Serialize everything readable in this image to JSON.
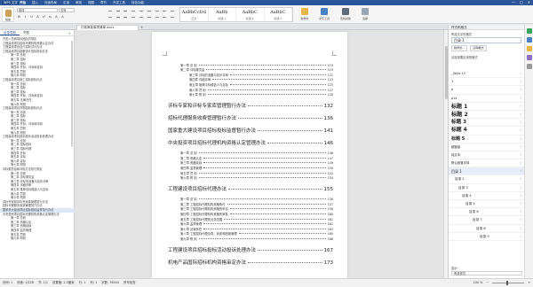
{
  "app": {
    "logo": "WPS 文字",
    "menu": [
      "开始",
      "插入",
      "页面布局",
      "引用",
      "审阅",
      "视图",
      "章节",
      "开发工具",
      "特色功能"
    ],
    "active_menu": "开始",
    "window_buttons": [
      "—",
      "□",
      "×"
    ]
  },
  "ribbon": {
    "paste_label": "粘贴",
    "font_name": "宋体",
    "font_size": "五号",
    "format_buttons": [
      "B",
      "I",
      "U",
      "A",
      "x²",
      "x₂",
      "A",
      "A"
    ],
    "styles": [
      {
        "preview": "AaBbCcDd",
        "name": "正文"
      },
      {
        "preview": "AaBb",
        "name": "标题 1"
      },
      {
        "preview": "AaBbC",
        "name": "标题 2"
      },
      {
        "preview": "AaBbC",
        "name": "标题 3"
      }
    ],
    "new_style_label": "新样式",
    "text_tools_label": "文字工具",
    "find_replace_label": "查找替换",
    "select_label": "选择"
  },
  "tabs": {
    "doc_tab": "行政审批事项清单.docx",
    "plus": "+"
  },
  "left_pane": {
    "tabs": [
      "目录导航",
      "书签"
    ],
    "close": "×",
    "outline": [
      "开发人员和招标团队的规定",
      "工程建设项目招标代理机构资格认定办法",
      "工程建设项目自行招标试行办法",
      "工程建设项目勘察设计招标投标办法",
      "  第一章  总则",
      "  第二章  招标",
      "  第三章  投标",
      "  第四章  开标、评标和定标",
      "  第五章  罚则",
      "  第六章  附则",
      "工程建设项目施工招标投标办法",
      "  第一章  总则",
      "  第二章  招标",
      "  第三章  投标",
      "  第四章  开标、评标和定标",
      "  第五章  法律责任",
      "  第六章  附则",
      "工程建设项目货物招标投标办法",
      "  第一章  总则",
      "  第二章  招标",
      "  第三章  投标",
      "  第四章  开标、评标和中标",
      "  第五章  罚则",
      "  第六章  附则",
      "工程建设项目招标投标活动投诉处理办法",
      "  第一章  总则",
      "  第二章  招标投标",
      "  第三章  招标代理",
      "  第四章  开标",
      "  第五章  评标",
      "  第六章  定标",
      "  第七章  附则",
      "评标委员会和评标方法暂行规定",
      "  第一章  总则",
      "  第二章  评标委员会",
      "  第三章  评标的准备与初步评审",
      "  第四章  详细评审",
      "  第五章  推荐中标候选人与定标",
      "  第六章  罚则",
      "  第七章  附则",
      "评标专家和评标专家库管理暂行办法",
      "招标代理服务收费管理暂行办法",
      "国家重大建设项目招标投标监督暂行办法",
      "中央投资项目招标代理机构资格认定管理办法",
      "  第一章  总则",
      "  第二章  资格认定",
      "  第三章  资格延续",
      "  第四章  监督管理",
      "  第五章  罚则",
      "  第六章  附则"
    ],
    "selected_index": 42
  },
  "document": {
    "toc": [
      {
        "level": 2,
        "title": "第一章  总  则",
        "page": "119"
      },
      {
        "level": 2,
        "title": "第二章  评标委员会",
        "page": "119"
      },
      {
        "level": 3,
        "title": "第三章  评标的准备与初步评审",
        "page": "121"
      },
      {
        "level": 3,
        "title": "第四章  详细评审",
        "page": "123"
      },
      {
        "level": 3,
        "title": "第五章  推荐中标候选人与定标",
        "page": "125"
      },
      {
        "level": 3,
        "title": "第六章  罚  则",
        "page": "127"
      },
      {
        "level": 3,
        "title": "第七章  附  则",
        "page": "128"
      },
      {
        "level": 1,
        "title": "评标专家和评标专家库管理暂行办法",
        "page": "132"
      },
      {
        "level": 1,
        "title": "招标代理服务收费管理暂行办法",
        "page": "136"
      },
      {
        "level": 1,
        "title": "国家重大建设项目招标投标监督暂行办法",
        "page": "141"
      },
      {
        "level": 1,
        "title": "中央投资项目招标代理机构资格认定管理办法",
        "page": "146"
      },
      {
        "level": 2,
        "title": "第一章  总  则",
        "page": "146"
      },
      {
        "level": 2,
        "title": "第二章  资格认定",
        "page": "147"
      },
      {
        "level": 2,
        "title": "第三章  资格延续",
        "page": "149"
      },
      {
        "level": 2,
        "title": "第四章  监督管理",
        "page": "150"
      },
      {
        "level": 2,
        "title": "第五章  罚  则",
        "page": "152"
      },
      {
        "level": 2,
        "title": "第六章  附  则",
        "page": "154"
      },
      {
        "level": 1,
        "title": "工程建设项目招标代理办法",
        "page": "155"
      },
      {
        "level": 2,
        "title": "第一章  总  则",
        "page": "156"
      },
      {
        "level": 2,
        "title": "第二章  工程招标代理机构资格条件",
        "page": "157"
      },
      {
        "level": 2,
        "title": "第三章  工程招标代理机构资格的申请",
        "page": "158"
      },
      {
        "level": 2,
        "title": "第四章  工程招标代理机构资格的审批",
        "page": "160"
      },
      {
        "level": 2,
        "title": "第五章  工程招标代理的业务范围",
        "page": "161"
      },
      {
        "level": 2,
        "title": "第六章  监督管理",
        "page": "162"
      },
      {
        "level": 2,
        "title": "第七章  法律责任",
        "page": "163"
      },
      {
        "level": 2,
        "title": "第八章  工程招标代理合同、收费和档案管理",
        "page": "165"
      },
      {
        "level": 2,
        "title": "第九章  附  则",
        "page": "166"
      },
      {
        "level": 1,
        "title": "工程建设项目招标投标活动投诉处理办法",
        "page": "167"
      },
      {
        "level": 1,
        "title": "机电产品国际招标机构资格审定办法",
        "page": "173"
      }
    ]
  },
  "right_pane": {
    "header": "样式和格式",
    "current_label": "所选文字的格式",
    "current_style": "目录 1",
    "buttons": [
      "新样式...",
      "清除格式"
    ],
    "list_label": "请选择要应用的格式",
    "styles": [
      {
        "name": "_Style 13",
        "size": 3.4
      },
      {
        "name": "1",
        "size": 3.6
      },
      {
        "name": "a",
        "size": 3.6
      },
      {
        "name": "p14",
        "size": 3.4
      },
      {
        "name": "标题 1",
        "size": 6.0
      },
      {
        "name": "标题 2",
        "size": 6.2
      },
      {
        "name": "标题 3",
        "size": 5.6
      },
      {
        "name": "标题 4",
        "size": 5.8
      },
      {
        "name": "标题 5",
        "size": 5.0
      },
      {
        "name": "超链接",
        "size": 3.4
      },
      {
        "name": "纯文本",
        "size": 3.4
      },
      {
        "name": "默认段落字体",
        "size": 3.4
      },
      {
        "name": "目录 1",
        "size": 4.0
      },
      {
        "name": "目录 2",
        "size": 3.6
      },
      {
        "name": "目录 3",
        "size": 3.6
      },
      {
        "name": "目录 4",
        "size": 3.6
      },
      {
        "name": "目录 5",
        "size": 3.6
      },
      {
        "name": "目录 6",
        "size": 3.6
      },
      {
        "name": "目录 7",
        "size": 3.6
      },
      {
        "name": "目录 8",
        "size": 3.6
      },
      {
        "name": "目录 9",
        "size": 3.6
      }
    ],
    "footer_label": "显示:",
    "footer_value": "有效样式"
  },
  "status": {
    "left": [
      "页码: 1",
      "页面: 1/226",
      "节: 1/1",
      "设置值: 2.5厘米",
      "行: 1",
      "列: 1",
      "字数: 76544",
      "拼写检查"
    ],
    "zoom": "100 %"
  },
  "colors": {
    "title_bar": "#2b579a",
    "accent": "#2b579a"
  }
}
